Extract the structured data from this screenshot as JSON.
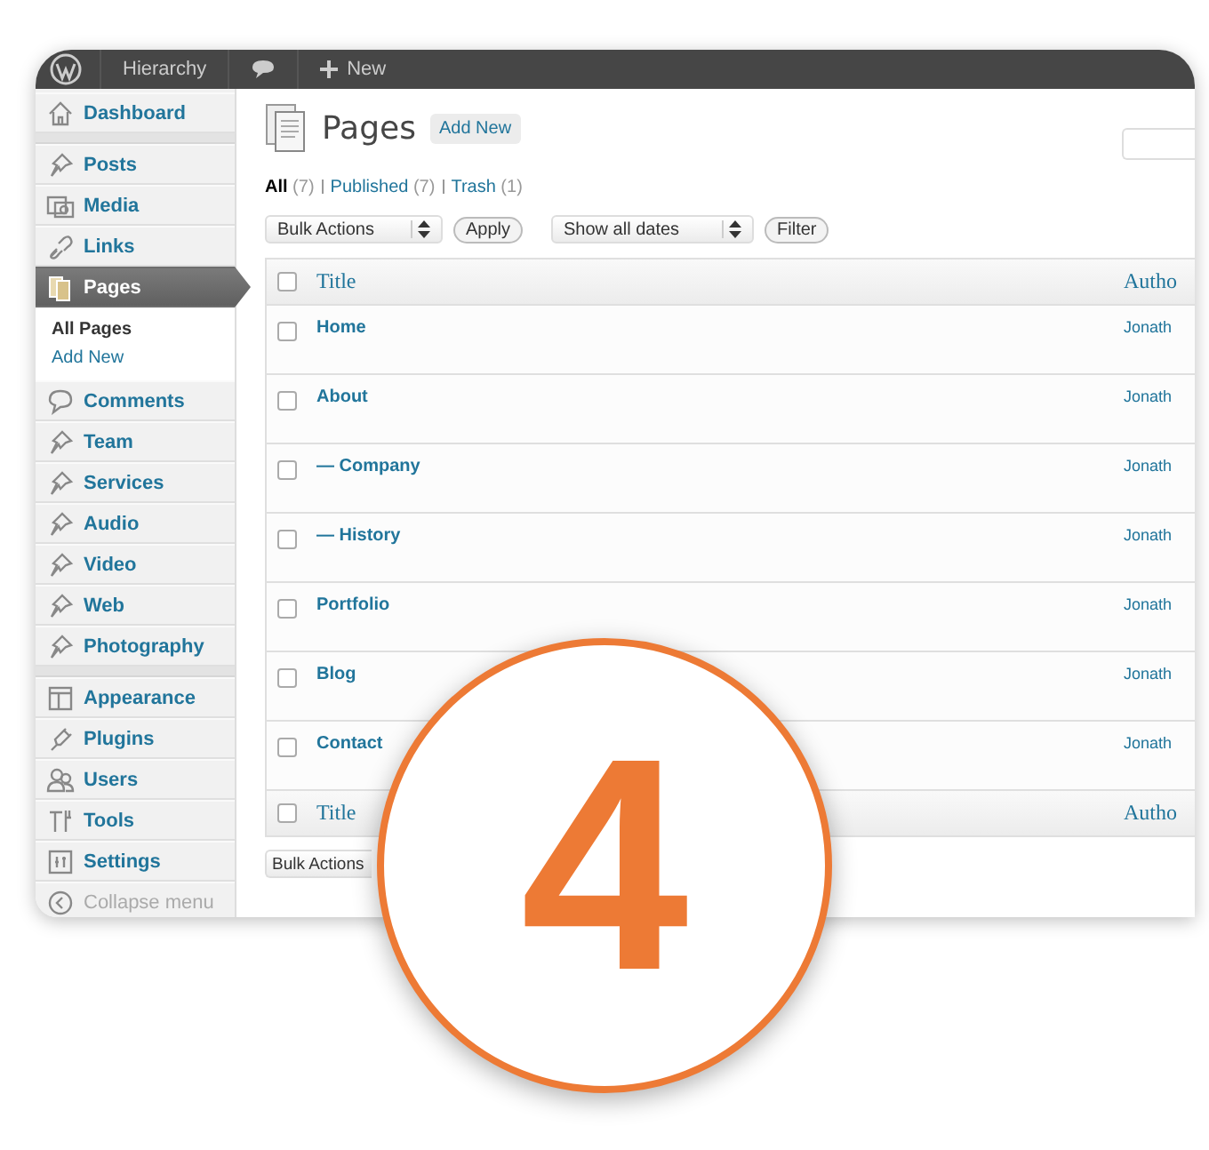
{
  "admin_bar": {
    "site": "Hierarchy",
    "new": "New"
  },
  "sidebar": {
    "groups": [
      [
        {
          "label": "Dashboard",
          "selected": false
        }
      ],
      [
        {
          "label": "Posts",
          "selected": false
        },
        {
          "label": "Media",
          "selected": false
        },
        {
          "label": "Links",
          "selected": false
        },
        {
          "label": "Pages",
          "selected": true,
          "children": [
            {
              "label": "All Pages",
              "selected": true
            },
            {
              "label": "Add New",
              "selected": false
            }
          ]
        },
        {
          "label": "Comments",
          "selected": false
        },
        {
          "label": "Team",
          "selected": false
        },
        {
          "label": "Services",
          "selected": false
        },
        {
          "label": "Audio",
          "selected": false
        },
        {
          "label": "Video",
          "selected": false
        },
        {
          "label": "Web",
          "selected": false
        },
        {
          "label": "Photography",
          "selected": false
        }
      ],
      [
        {
          "label": "Appearance",
          "selected": false
        },
        {
          "label": "Plugins",
          "selected": false
        },
        {
          "label": "Users",
          "selected": false
        },
        {
          "label": "Tools",
          "selected": false
        },
        {
          "label": "Settings",
          "selected": false
        },
        {
          "label": "Collapse menu",
          "selected": false
        }
      ]
    ]
  },
  "page": {
    "title": "Pages",
    "add_new": "Add New"
  },
  "views": [
    {
      "label": "All",
      "count": "(7)",
      "selected": true
    },
    {
      "label": "Published",
      "count": "(7)",
      "selected": false
    },
    {
      "label": "Trash",
      "count": "(1)",
      "selected": false
    }
  ],
  "filters": {
    "bulk_actions": "Bulk Actions",
    "apply": "Apply",
    "dates": "Show all dates",
    "filter": "Filter"
  },
  "table": {
    "columns": [
      "Title",
      "Autho"
    ],
    "rows": [
      {
        "title": "Home",
        "author": "Jonath",
        "checked": false
      },
      {
        "title": "About",
        "author": "Jonath",
        "checked": false
      },
      {
        "title": "— Company",
        "author": "Jonath",
        "checked": false
      },
      {
        "title": "— History",
        "author": "Jonath",
        "checked": false
      },
      {
        "title": "Portfolio",
        "author": "Jonath",
        "checked": false
      },
      {
        "title": "Blog",
        "author": "Jonath",
        "checked": false
      },
      {
        "title": "Contact",
        "author": "Jonath",
        "checked": false
      }
    ],
    "footer_columns": [
      "Title",
      "Autho"
    ],
    "header_checked": false,
    "footer_checked": false
  },
  "bottom_bulk_actions": "Bulk Actions",
  "badge": "4"
}
